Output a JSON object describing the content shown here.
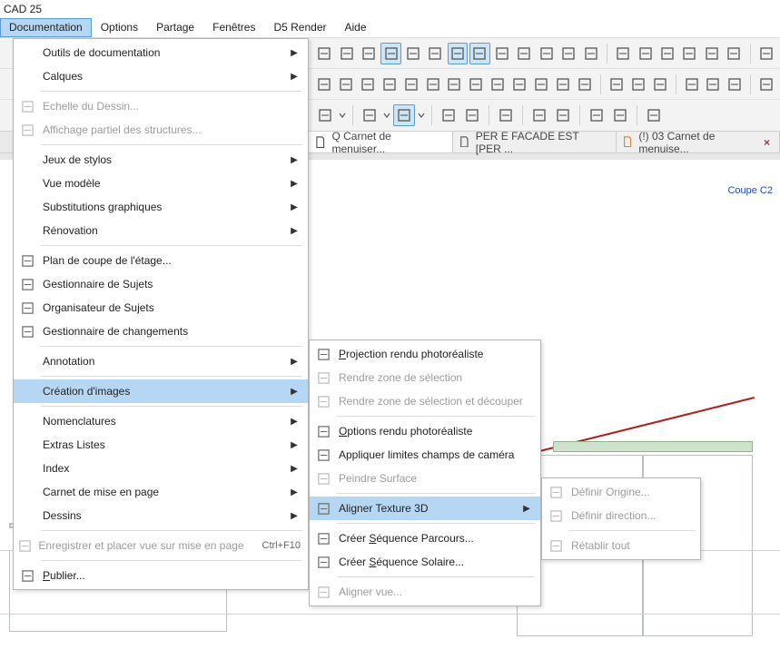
{
  "title": "CAD 25",
  "menubar": {
    "items": [
      "Documentation",
      "Options",
      "Partage",
      "Fenêtres",
      "D5 Render",
      "Aide"
    ],
    "active_index": 0
  },
  "toolbar": {
    "row1_left_offset": true,
    "row1_icons": [
      "page",
      "frame",
      "ruler-h",
      "crop",
      "grid-plus",
      "angle",
      "texture",
      "rotate",
      "circle",
      "line",
      "star",
      "layout",
      "layers",
      "sep",
      "scissors",
      "pick",
      "brush",
      "align",
      "cursor",
      "double",
      "sep",
      "bold"
    ],
    "row1_active": [
      3,
      6,
      7
    ],
    "row2_icons": [
      "link",
      "beam",
      "col",
      "wing",
      "wave",
      "dome",
      "stair",
      "ramp",
      "rail",
      "grid9",
      "bulb",
      "light",
      "spot",
      "sep",
      "id",
      "shield",
      "ribbon",
      "sep",
      "tag1",
      "tag2",
      "cube",
      "sep",
      "panel"
    ],
    "row3_icons": [
      "gear",
      "drop",
      "sep",
      "home",
      "drop",
      "paint",
      "drop",
      "sep",
      "folder",
      "tool",
      "sep",
      "camera",
      "sep",
      "film",
      "record",
      "sep",
      "monitor",
      "fx",
      "sep",
      "refresh"
    ],
    "row3_active": [
      5
    ]
  },
  "tabs": [
    {
      "label": "Q Carnet de menuiser...",
      "alert": false
    },
    {
      "label": "PER E FACADE EST [PER ...",
      "alert": false
    },
    {
      "label": "(!) 03 Carnet de menuise...",
      "alert": true
    }
  ],
  "canvas": {
    "section_label": "Coupe C2"
  },
  "menu_documentation": {
    "items": [
      {
        "label": "Outils de documentation",
        "submenu": true
      },
      {
        "label": "Calques",
        "submenu": true
      },
      {
        "label": "Echelle du Dessin...",
        "disabled": true,
        "icon": "scale"
      },
      {
        "label": "Affichage partiel des structures...",
        "disabled": true,
        "icon": "partial-disp"
      },
      {
        "label": "Jeux de stylos",
        "submenu": true
      },
      {
        "label": "Vue modèle",
        "submenu": true
      },
      {
        "label": "Substitutions graphiques",
        "submenu": true
      },
      {
        "label": "Rénovation",
        "submenu": true
      },
      {
        "label": "Plan de coupe de l'étage...",
        "icon": "section-plane"
      },
      {
        "label": "Gestionnaire de Sujets",
        "icon": "subject-mgr"
      },
      {
        "label": "Organisateur de Sujets",
        "icon": "subject-org"
      },
      {
        "label": "Gestionnaire de changements",
        "icon": "change-mgr"
      },
      {
        "label": "Annotation",
        "submenu": true
      },
      {
        "label": "Création d'images",
        "submenu": true,
        "highlight": true
      },
      {
        "label": "Nomenclatures",
        "submenu": true
      },
      {
        "label": "Extras Listes",
        "submenu": true
      },
      {
        "label": "Index",
        "submenu": true
      },
      {
        "label": "Carnet de mise en page",
        "submenu": true
      },
      {
        "label": "Dessins",
        "submenu": true
      },
      {
        "label": "Enregistrer et placer vue sur mise en page",
        "disabled": true,
        "icon": "save-place",
        "shortcut": "Ctrl+F10"
      },
      {
        "label": "Publier...",
        "icon": "publish",
        "underline_first": true
      }
    ],
    "separators_after": [
      1,
      3,
      7,
      11,
      12,
      13,
      18,
      19
    ]
  },
  "menu_creation_images": {
    "items": [
      {
        "label": "Projection rendu photoréaliste",
        "icon": "render",
        "underline_first": true
      },
      {
        "label": "Rendre zone de sélection",
        "icon": "render-sel",
        "disabled": true
      },
      {
        "label": "Rendre zone de sélection et découper",
        "icon": "render-crop",
        "disabled": true
      },
      {
        "label": "Options rendu photoréaliste",
        "icon": "render-opts",
        "underline_first": true
      },
      {
        "label": "Appliquer limites champs de caméra",
        "icon": "camera-limits"
      },
      {
        "label": "Peindre Surface",
        "icon": "paint-surface",
        "disabled": true
      },
      {
        "label": "Aligner Texture 3D",
        "icon": "align-tex",
        "submenu": true,
        "highlight": true
      },
      {
        "label": "Créer Séquence Parcours...",
        "icon": "seq-path",
        "underline_at": 6
      },
      {
        "label": "Créer Séquence Solaire...",
        "icon": "seq-sun",
        "underline_at": 6
      },
      {
        "label": "Aligner vue...",
        "icon": "align-view",
        "disabled": true
      }
    ],
    "separators_after": [
      2,
      5,
      6,
      8
    ]
  },
  "menu_align_texture": {
    "items": [
      {
        "label": "Définir Origine...",
        "icon": "origin",
        "disabled": true
      },
      {
        "label": "Définir direction...",
        "icon": "direction",
        "disabled": true
      },
      {
        "label": "Rétablir tout",
        "icon": "reset",
        "disabled": true
      }
    ],
    "separators_after": [
      1
    ]
  }
}
